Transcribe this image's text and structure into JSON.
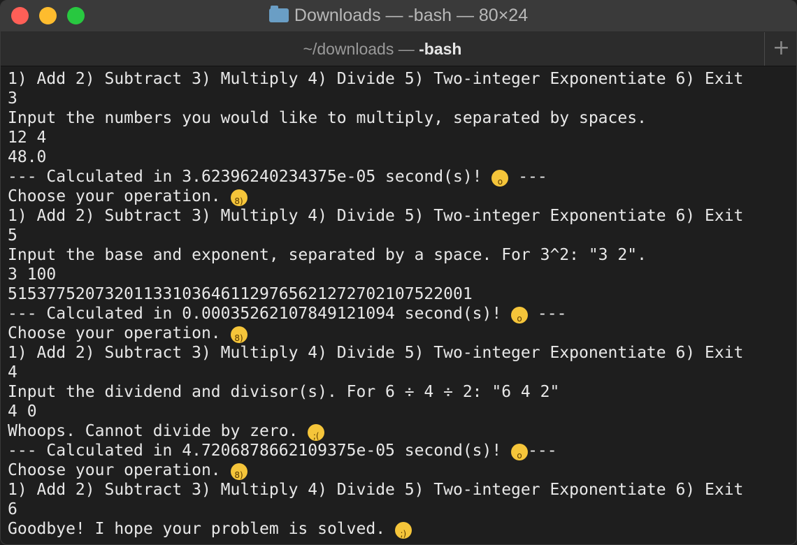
{
  "window": {
    "title": "Downloads — -bash — 80×24",
    "folder_icon": "folder-icon"
  },
  "tab": {
    "path": "~/downloads — ",
    "process": "-bash",
    "new_tab_label": "+"
  },
  "terminal": {
    "lines": [
      {
        "text": "1) Add 2) Subtract 3) Multiply 4) Divide 5) Two-integer Exponentiate 6) Exit"
      },
      {
        "text": "3"
      },
      {
        "text": "Input the numbers you would like to multiply, separated by spaces."
      },
      {
        "text": "12 4"
      },
      {
        "text": "48.0"
      },
      {
        "text": "--- Calculated in 3.62396240234375e-05 second(s)! ",
        "emoji": "astonished-face-icon",
        "after": " ---"
      },
      {
        "text": "Choose your operation. ",
        "emoji": "nerd-face-icon",
        "after": ""
      },
      {
        "text": "1) Add 2) Subtract 3) Multiply 4) Divide 5) Two-integer Exponentiate 6) Exit"
      },
      {
        "text": "5"
      },
      {
        "text": "Input the base and exponent, separated by a space. For 3^2: \"3 2\"."
      },
      {
        "text": "3 100"
      },
      {
        "text": "515377520732011331036461129765621272702107522001"
      },
      {
        "text": "--- Calculated in 0.00035262107849121094 second(s)! ",
        "emoji": "astonished-face-icon",
        "after": " ---"
      },
      {
        "text": "Choose your operation. ",
        "emoji": "nerd-face-icon",
        "after": ""
      },
      {
        "text": "1) Add 2) Subtract 3) Multiply 4) Divide 5) Two-integer Exponentiate 6) Exit"
      },
      {
        "text": "4"
      },
      {
        "text": "Input the dividend and divisor(s). For 6 ÷ 4 ÷ 2: \"6 4 2\""
      },
      {
        "text": "4 0"
      },
      {
        "text": "Whoops. Cannot divide by zero. ",
        "emoji": "loudly-crying-face-icon",
        "after": ""
      },
      {
        "text": "--- Calculated in 4.7206878662109375e-05 second(s)! ",
        "emoji": "astonished-face-icon",
        "after": "---"
      },
      {
        "text": "Choose your operation. ",
        "emoji": "nerd-face-icon",
        "after": ""
      },
      {
        "text": "1) Add 2) Subtract 3) Multiply 4) Divide 5) Two-integer Exponentiate 6) Exit"
      },
      {
        "text": "6"
      },
      {
        "text": "Goodbye! I hope your problem is solved. ",
        "emoji": "smirking-face-icon",
        "after": ""
      }
    ]
  },
  "colors": {
    "background": "#1e1e1e",
    "foreground": "#e8e8e8",
    "titlebar": "#3a3a3a",
    "close": "#ff5f57",
    "minimize": "#febc2e",
    "maximize": "#28c840"
  }
}
